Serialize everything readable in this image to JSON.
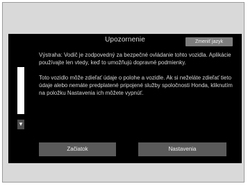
{
  "screen": {
    "title": "Upozornenie",
    "lang_button": "Zmeniť jazyk",
    "paragraph_1": "Výstraha: Vodič je zodpovedný za bezpečné ovládanie tohto vozidla. Aplikácie používajte len vtedy, keď to umožňujú dopravné podmienky.",
    "paragraph_2": "Toto vozidlo môže zdieľať údaje o polohe a vozidle. Ak si neželáte zdieľať tieto údaje alebo nemáte predplatené pripojené služby spoločnosti Honda, kliknutím na položku Nastavenia ich môžete vypnúť.",
    "scroll_down_symbol": "▼",
    "start_button": "Začiatok",
    "settings_button": "Nastavenia"
  },
  "icons": {
    "scroll_down": "arrow-down-icon"
  }
}
